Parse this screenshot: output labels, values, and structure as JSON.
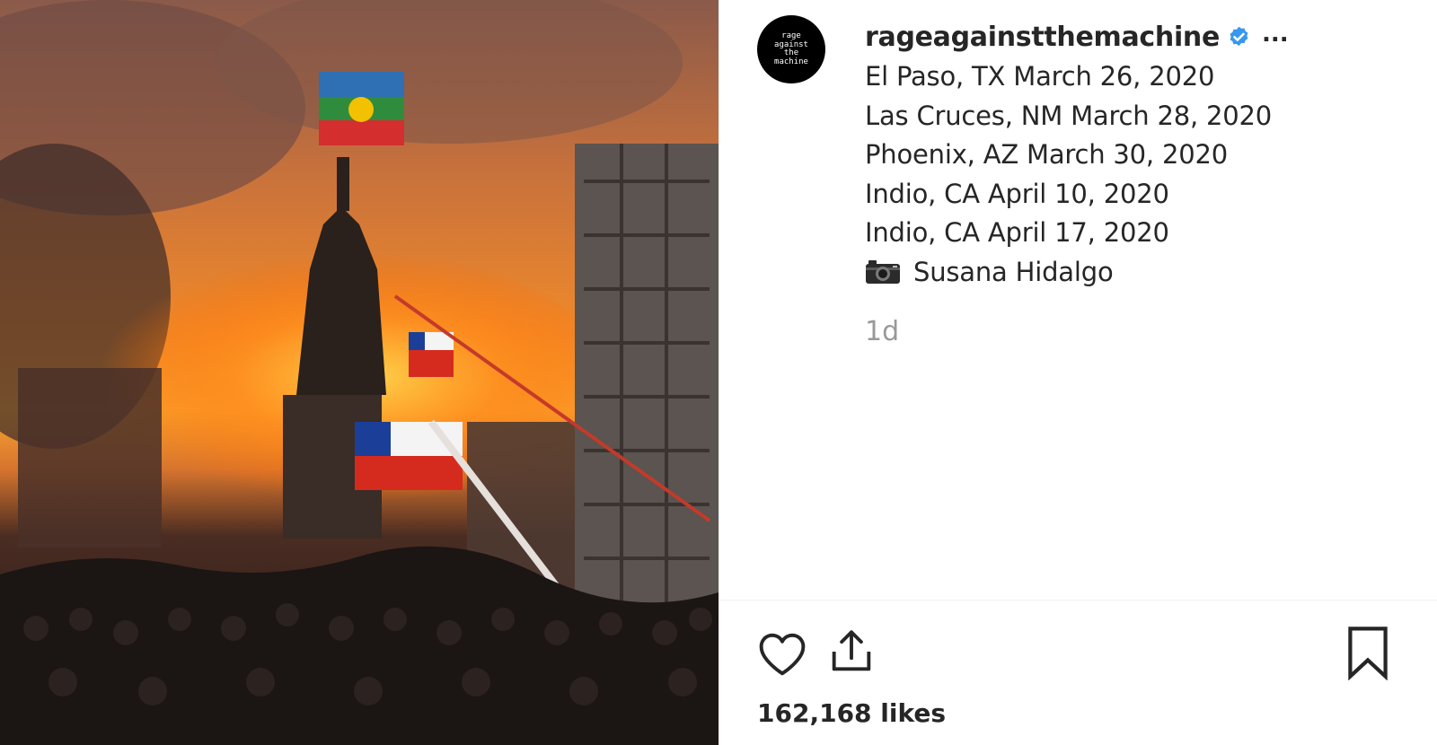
{
  "photo": {
    "description_icon": "photo"
  },
  "avatar": {
    "lines": [
      "rage",
      "against",
      "the",
      "machine"
    ]
  },
  "post": {
    "username": "rageagainstthemachine",
    "more_label": "...",
    "caption_lines": [
      "El Paso, TX March 26, 2020",
      "Las Cruces, NM March 28, 2020",
      "Phoenix, AZ March 30, 2020",
      "Indio, CA April 10, 2020",
      "Indio, CA April 17, 2020"
    ],
    "credit": "Susana Hidalgo",
    "timestamp": "1d",
    "likes": "162,168 likes"
  },
  "icons": {
    "verified": "verified-badge-icon",
    "camera": "camera-icon",
    "like": "heart-icon",
    "share": "share-icon",
    "save": "bookmark-icon"
  },
  "colors": {
    "verified": "#3897f0",
    "text": "#262626",
    "muted": "#999999"
  }
}
